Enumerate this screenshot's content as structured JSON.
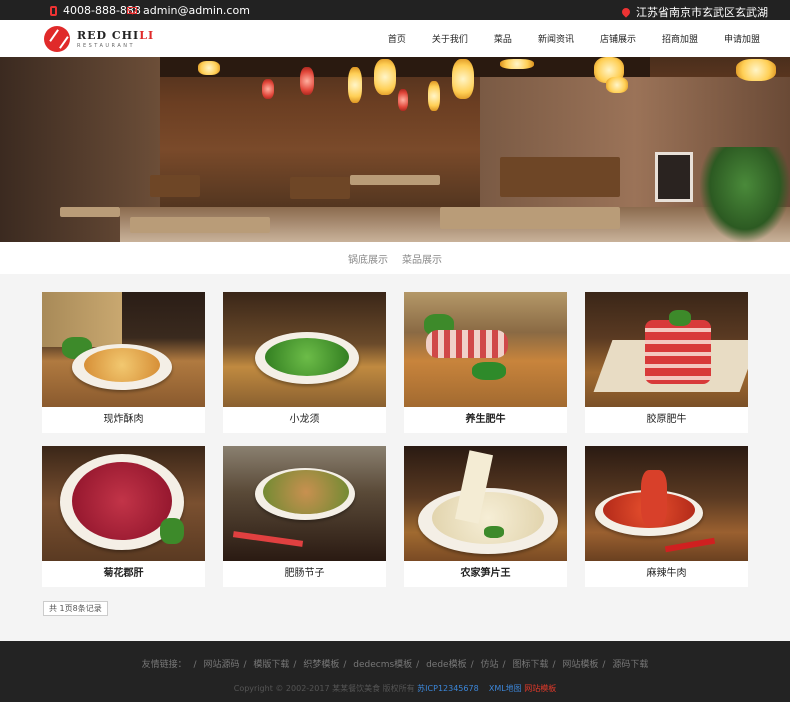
{
  "topbar": {
    "phone": "4008-888-888",
    "email": "admin@admin.com",
    "address": "江苏省南京市玄武区玄武湖"
  },
  "logo": {
    "name_dark": "RED CHI",
    "name_red": "LI",
    "sub": "RESTAURANT"
  },
  "nav": [
    "首页",
    "关于我们",
    "菜品",
    "新闻资讯",
    "店铺展示",
    "招商加盟",
    "申请加盟"
  ],
  "tabs": [
    "锅底展示",
    "菜品展示"
  ],
  "dishes": [
    {
      "name": "现炸酥肉",
      "bold": false
    },
    {
      "name": "小龙须",
      "bold": false
    },
    {
      "name": "养生肥牛",
      "bold": true
    },
    {
      "name": "胶原肥牛",
      "bold": false
    },
    {
      "name": "菊花郡肝",
      "bold": true
    },
    {
      "name": "肥肠节子",
      "bold": false
    },
    {
      "name": "农家笋片王",
      "bold": true
    },
    {
      "name": "麻辣牛肉",
      "bold": false
    }
  ],
  "pager": "共 1页8条记录",
  "footer": {
    "links_label": "友情链接：",
    "links": [
      "网站源码",
      "模版下载",
      "织梦模板",
      "dedecms模板",
      "dede模板",
      "仿站",
      "图标下载",
      "网站模板",
      "源码下载"
    ],
    "copyright": "Copyright © 2002-2017 某某餐饮美食 版权所有",
    "icp": "苏ICP12345678",
    "xml": "XML地图",
    "template": "网站模板"
  },
  "colors": {
    "accent": "#e02a2a",
    "topbar_bg": "#222222",
    "footer_bg": "#232323",
    "link_blue": "#3c86d8"
  }
}
